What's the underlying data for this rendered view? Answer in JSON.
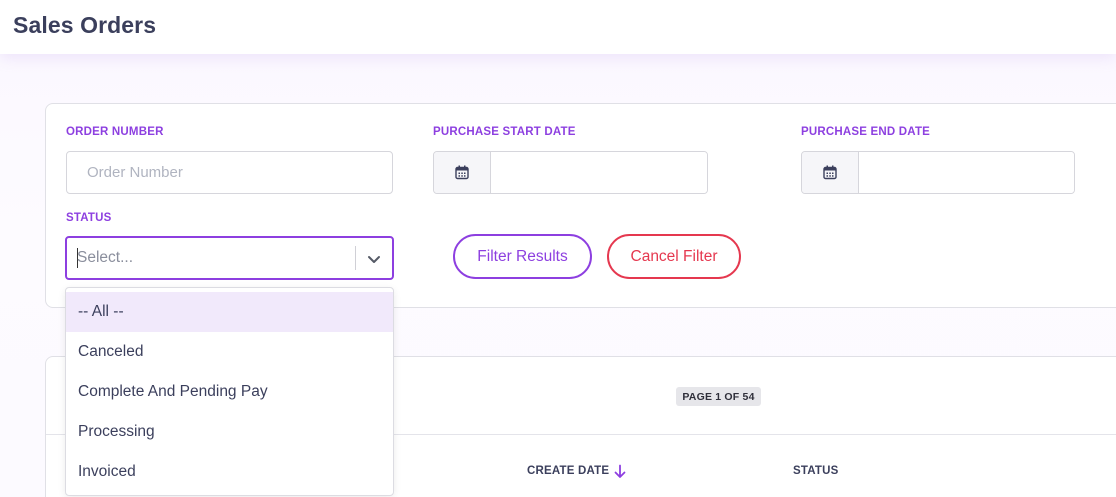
{
  "header": {
    "title": "Sales Orders"
  },
  "filters": {
    "order_number": {
      "label": "ORDER NUMBER",
      "placeholder": "Order Number",
      "value": ""
    },
    "purchase_start_date": {
      "label": "PURCHASE START DATE",
      "value": ""
    },
    "purchase_end_date": {
      "label": "PURCHASE END DATE",
      "value": ""
    },
    "status": {
      "label": "STATUS",
      "value": "Select..."
    },
    "filter_button": "Filter Results",
    "cancel_button": "Cancel Filter"
  },
  "status_options": [
    "-- All --",
    "Canceled",
    "Complete And Pending Pay",
    "Processing",
    "Invoiced"
  ],
  "results": {
    "page_indicator": "PAGE 1 OF 54",
    "columns": [
      "CREATE DATE",
      "STATUS"
    ]
  },
  "colors": {
    "accent": "#8d3fe0",
    "danger": "#e5384f",
    "text": "#3b3f5c"
  },
  "icons": {
    "date": "calendar-icon",
    "select": "chevron-down-icon",
    "sort": "arrow-down-icon"
  }
}
